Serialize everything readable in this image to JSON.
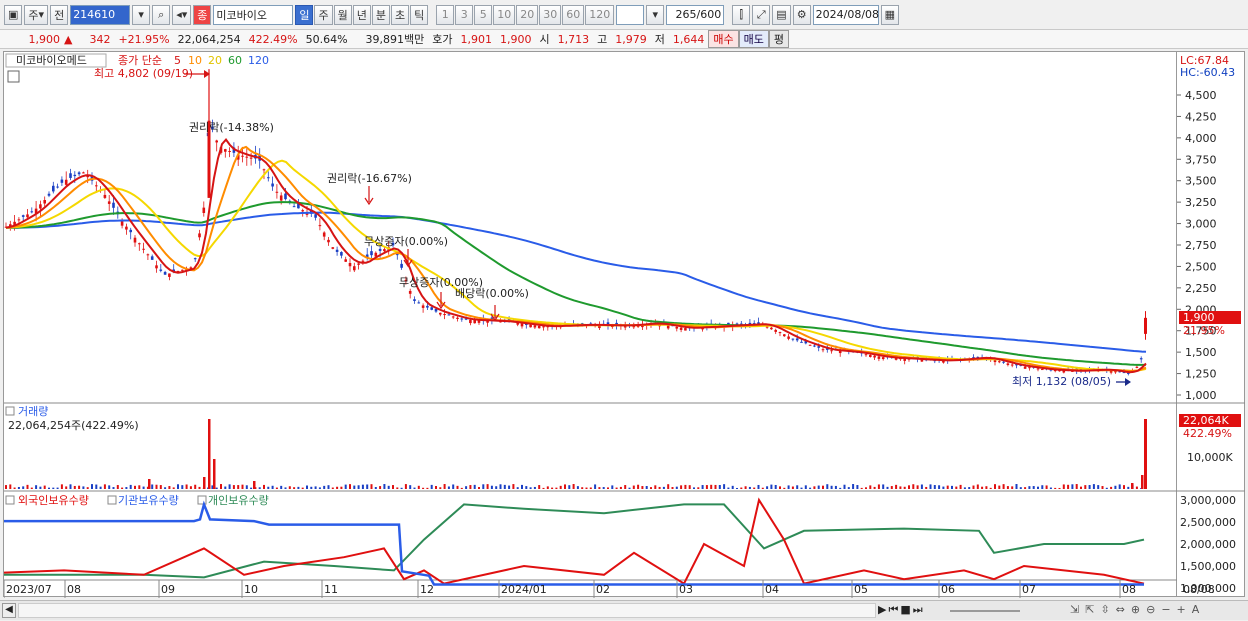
{
  "toolbar": {
    "market": "주",
    "prev_label": "전",
    "code": "214610",
    "badge": "종",
    "name": "미코바이오",
    "periods": [
      "일",
      "주",
      "월",
      "년",
      "분",
      "초",
      "틱"
    ],
    "minutes": [
      "1",
      "3",
      "5",
      "10",
      "20",
      "30",
      "60",
      "120"
    ],
    "count": "265",
    "count_total": "/600",
    "date": "2024/08/08"
  },
  "quote": {
    "price": "1,900",
    "arrow": "▲",
    "change": "342",
    "change_pct": "+21.95%",
    "volume": "22,064,254",
    "vol_pct": "422.49%",
    "ratio": "50.64%",
    "amount": "39,891백만",
    "hoga_label": "호가",
    "ask": "1,901",
    "bid": "1,900",
    "open_label": "시",
    "open": "1,713",
    "high_label": "고",
    "high": "1,979",
    "low_label": "저",
    "low": "1,644",
    "buy": "매수",
    "sell": "매도",
    "eval": "평"
  },
  "price_panel": {
    "name_tag": "미코바이오메드",
    "ma_label": "종가 단순",
    "ma_periods": [
      "5",
      "10",
      "20",
      "60",
      "120"
    ],
    "ma_colors": [
      "#d61414",
      "#ff8c00",
      "#f5d800",
      "#1f9a2e",
      "#2a5ce8"
    ],
    "lc": "LC:67.84",
    "hc": "HC:-60.43",
    "y_ticks": [
      "4,500",
      "4,250",
      "4,000",
      "3,750",
      "3,500",
      "3,250",
      "3,000",
      "2,750",
      "2,500",
      "2,250",
      "2,000",
      "1,750",
      "1,500",
      "1,250",
      "1,000"
    ],
    "y_tick_values": [
      4500,
      4250,
      4000,
      3750,
      3500,
      3250,
      3000,
      2750,
      2500,
      2250,
      2000,
      1750,
      1500,
      1250,
      1000
    ],
    "last_price": "1,900",
    "last_pct": "21.95%",
    "annotations": {
      "high": "최고 4,802 (09/19)",
      "rights1": "권리락(-14.38%)",
      "rights2": "권리락(-16.67%)",
      "bonus1": "무상증자(0.00%)",
      "bonus2": "무상증자(0.00%)",
      "dividend": "배당락(0.00%)",
      "low": "최저 1,132 (08/05)"
    }
  },
  "volume_panel": {
    "title": "거래량",
    "value": "22,064,254주(422.49%)",
    "last": "22,064K",
    "last_pct": "422.49%",
    "tick": "10,000K"
  },
  "holdings_panel": {
    "legend": [
      "외국인보유수량",
      "기관보유수량",
      "개인보유수량"
    ],
    "colors": [
      "#e01010",
      "#2a5ce8",
      "#2e8b57"
    ],
    "y_ticks": [
      "3,000,000",
      "2,500,000",
      "2,000,000",
      "1,500,000",
      "1,000,000"
    ]
  },
  "x_axis": {
    "labels": [
      "2023/07",
      "08",
      "09",
      "10",
      "11",
      "12",
      "2024/01",
      "02",
      "03",
      "04",
      "05",
      "06",
      "07",
      "08"
    ],
    "right_label": "08/08"
  }
}
